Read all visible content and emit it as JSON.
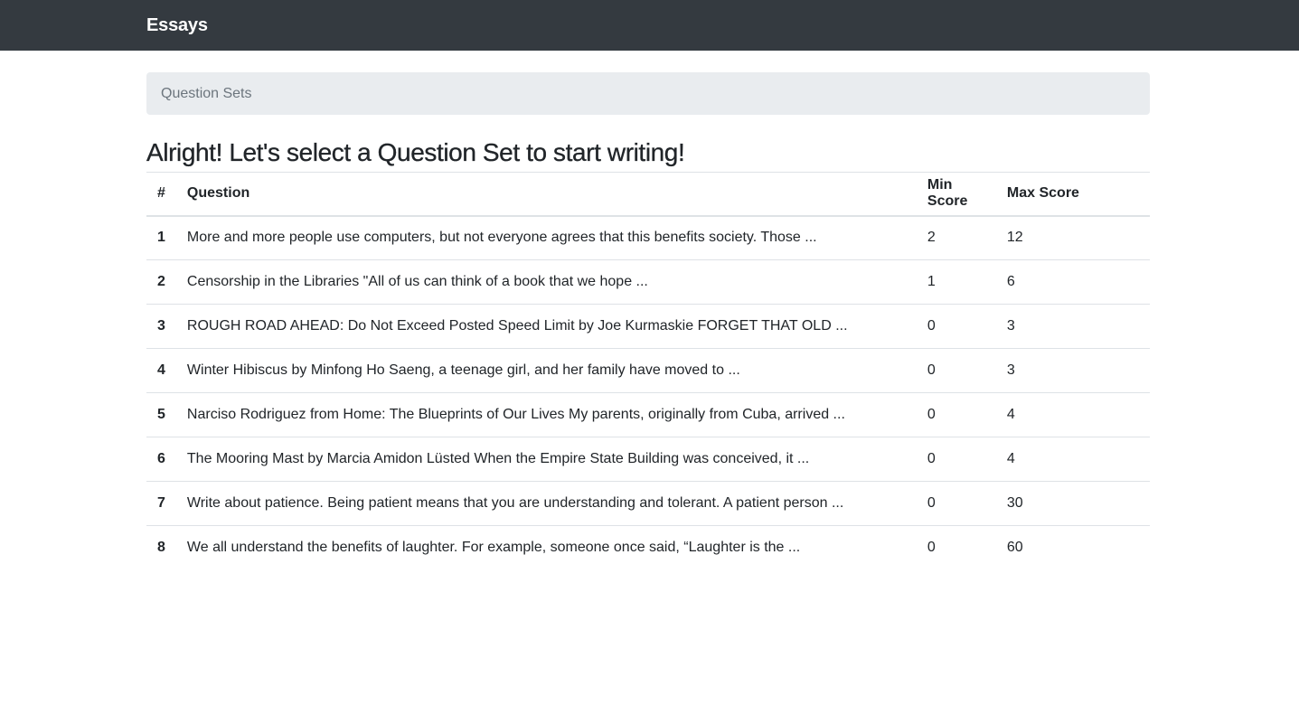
{
  "navbar": {
    "brand": "Essays"
  },
  "breadcrumb": {
    "items": [
      "Question Sets"
    ]
  },
  "page": {
    "title": "Alright! Let's select a Question Set to start writing!"
  },
  "table": {
    "headers": {
      "num": "#",
      "question": "Question",
      "min": "Min Score",
      "max": "Max Score"
    },
    "rows": [
      {
        "num": "1",
        "question": "More and more people use computers, but not everyone agrees that this benefits society. Those ...",
        "min": "2",
        "max": "12"
      },
      {
        "num": "2",
        "question": "Censorship in the Libraries \"All of us can think of a book that we hope ...",
        "min": "1",
        "max": "6"
      },
      {
        "num": "3",
        "question": "ROUGH ROAD AHEAD: Do Not Exceed Posted Speed Limit by Joe Kurmaskie FORGET THAT OLD ...",
        "min": "0",
        "max": "3"
      },
      {
        "num": "4",
        "question": "Winter Hibiscus by Minfong Ho Saeng, a teenage girl, and her family have moved to ...",
        "min": "0",
        "max": "3"
      },
      {
        "num": "5",
        "question": "Narciso Rodriguez from Home: The Blueprints of Our Lives My parents, originally from Cuba, arrived ...",
        "min": "0",
        "max": "4"
      },
      {
        "num": "6",
        "question": "The Mooring Mast by Marcia Amidon Lüsted When the Empire State Building was conceived, it ...",
        "min": "0",
        "max": "4"
      },
      {
        "num": "7",
        "question": "Write about patience. Being patient means that you are understanding and tolerant. A patient person ...",
        "min": "0",
        "max": "30"
      },
      {
        "num": "8",
        "question": "We all understand the benefits of laughter. For example, someone once said, “Laughter is the ...",
        "min": "0",
        "max": "60"
      }
    ]
  },
  "colors": {
    "navbar_bg": "#343a40",
    "breadcrumb_bg": "#e9ecef",
    "border": "#dee2e6",
    "text": "#212529",
    "muted": "#6c757d"
  }
}
